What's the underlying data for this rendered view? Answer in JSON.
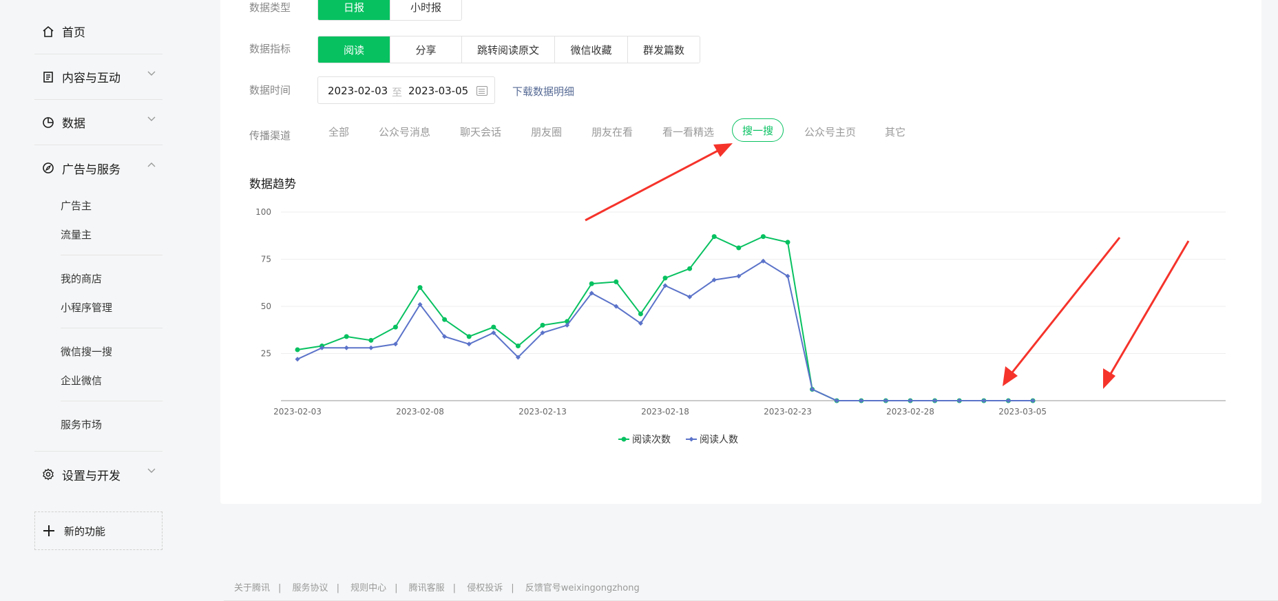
{
  "sidebar": {
    "home": "首页",
    "content": "内容与互动",
    "data": "数据",
    "ads": "广告与服务",
    "advertiser": "广告主",
    "publisher": "流量主",
    "my_store": "我的商店",
    "miniprogram": "小程序管理",
    "wechat_search": "微信搜一搜",
    "wecom": "企业微信",
    "service_market": "服务市场",
    "settings": "设置与开发",
    "new_feature": "新的功能"
  },
  "filters": {
    "data_type_label": "数据类型",
    "data_type_options": [
      "日报",
      "小时报"
    ],
    "metric_label": "数据指标",
    "metric_options": [
      "阅读",
      "分享",
      "跳转阅读原文",
      "微信收藏",
      "群发篇数"
    ],
    "time_label": "数据时间",
    "date_start": "2023-02-03",
    "date_to": "至",
    "date_end": "2023-03-05",
    "download": "下载数据明细",
    "channel_label": "传播渠道",
    "channels": [
      "全部",
      "公众号消息",
      "聊天会话",
      "朋友圈",
      "朋友在看",
      "看一看精选",
      "搜一搜",
      "公众号主页",
      "其它"
    ],
    "active_channel": "搜一搜"
  },
  "trend_title": "数据趋势",
  "chart_data": {
    "type": "line",
    "x": [
      "2023-02-03",
      "2023-02-04",
      "2023-02-05",
      "2023-02-06",
      "2023-02-07",
      "2023-02-08",
      "2023-02-09",
      "2023-02-10",
      "2023-02-11",
      "2023-02-12",
      "2023-02-13",
      "2023-02-14",
      "2023-02-15",
      "2023-02-16",
      "2023-02-17",
      "2023-02-18",
      "2023-02-19",
      "2023-02-20",
      "2023-02-21",
      "2023-02-22",
      "2023-02-23",
      "2023-02-24",
      "2023-02-25",
      "2023-02-26",
      "2023-02-27",
      "2023-02-28",
      "2023-03-01",
      "2023-03-02",
      "2023-03-03",
      "2023-03-04",
      "2023-03-05"
    ],
    "x_ticks": [
      "2023-02-03",
      "2023-02-08",
      "2023-02-13",
      "2023-02-18",
      "2023-02-23",
      "2023-02-28",
      "2023-03-05"
    ],
    "y_ticks": [
      25,
      50,
      75,
      100
    ],
    "ylim": [
      0,
      100
    ],
    "grid": true,
    "legend_position": "bottom",
    "series": [
      {
        "name": "阅读次数",
        "color": "#07c160",
        "marker": "circle",
        "values": [
          27,
          29,
          34,
          32,
          39,
          60,
          43,
          34,
          39,
          29,
          40,
          42,
          62,
          63,
          46,
          65,
          70,
          87,
          81,
          87,
          84,
          6,
          0,
          0,
          0,
          0,
          0,
          0,
          0,
          0,
          0
        ]
      },
      {
        "name": "阅读人数",
        "color": "#5b73c9",
        "marker": "diamond",
        "values": [
          22,
          28,
          28,
          28,
          30,
          51,
          34,
          30,
          36,
          23,
          36,
          40,
          57,
          50,
          41,
          61,
          55,
          64,
          66,
          74,
          66,
          6,
          0,
          0,
          0,
          0,
          0,
          0,
          0,
          0,
          0
        ]
      }
    ]
  },
  "footer": [
    "关于腾讯",
    "服务协议",
    "规则中心",
    "腾讯客服",
    "侵权投诉",
    "反馈官号weixingongzhong"
  ],
  "footer_sep": "|",
  "colors": {
    "accent": "#07c160",
    "link": "#576b95",
    "annotation": "#f5332b"
  }
}
